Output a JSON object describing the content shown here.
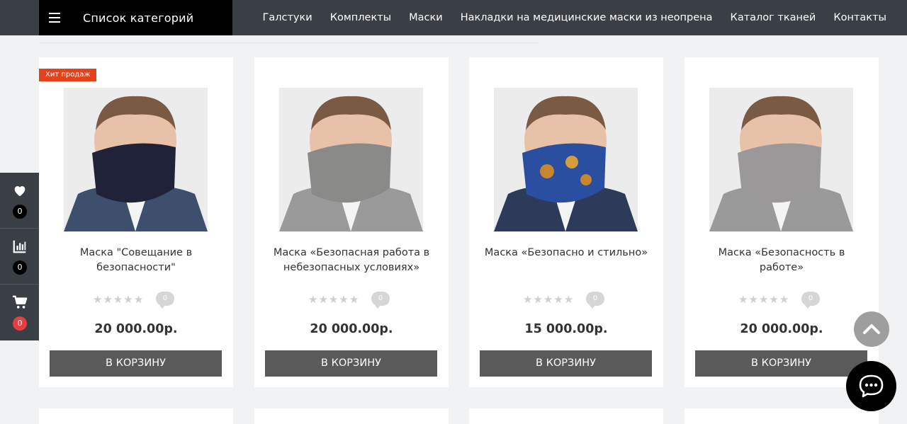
{
  "nav": {
    "category_label": "Список категорий",
    "menu": [
      "Галстуки",
      "Комплекты",
      "Маски",
      "Накладки на медицинские маски из неопрена",
      "Каталог тканей",
      "Контакты"
    ]
  },
  "sidedock": {
    "wishlist_count": "0",
    "compare_count": "0",
    "cart_count": "0"
  },
  "products": [
    {
      "badge": "Хит продаж",
      "title": "Маска \"Совещание в безопасности\"",
      "reviews": "0",
      "price": "20 000.00р.",
      "button": "В КОРЗИНУ",
      "mask_color": "#1f2238"
    },
    {
      "title": "Маска «Безопасная работа в небезопасных условиях»",
      "reviews": "0",
      "price": "20 000.00р.",
      "button": "В КОРЗИНУ",
      "mask_color": "#8a8a88"
    },
    {
      "title": "Маска «Безопасно и стильно»",
      "reviews": "0",
      "price": "15 000.00р.",
      "button": "В КОРЗИНУ",
      "mask_color": "#2a4ea0"
    },
    {
      "title": "Маска «Безопасность в работе»",
      "reviews": "0",
      "price": "20 000.00р.",
      "button": "В КОРЗИНУ",
      "mask_color": "#9a9898"
    }
  ],
  "colors": {
    "nav_bg": "#3a3e45",
    "badge": "#e2431d",
    "button": "#5a5a5a",
    "cart_count": "#e53f3f"
  },
  "icons": [
    "menu-icon",
    "heart-icon",
    "chart-icon",
    "cart-icon",
    "chevron-up-icon",
    "chat-icon"
  ]
}
